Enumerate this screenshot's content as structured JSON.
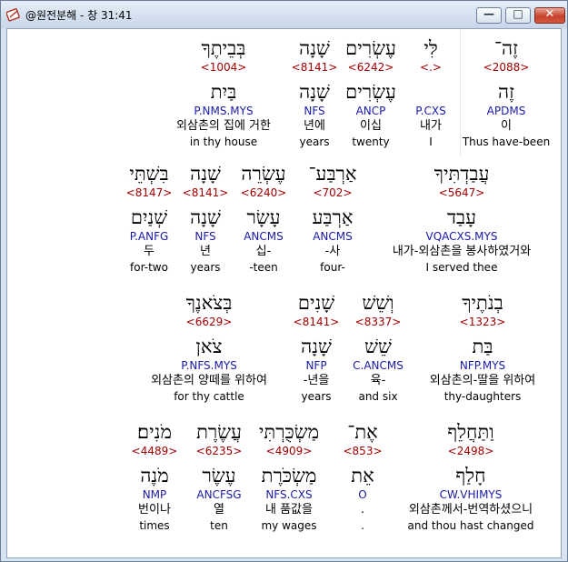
{
  "window": {
    "title": "@원전분해 - 창 31:41",
    "min_glyph": "—",
    "max_glyph": "□",
    "close_glyph": "✕"
  },
  "lines": [
    {
      "words": [
        {
          "heb": "זֶה־",
          "strong": "<2088>",
          "lex": "זֶה",
          "morph": "APDMS",
          "kor": "이",
          "eng": "Thus have-been"
        },
        {
          "heb": "לִּי",
          "strong": "<.>",
          "lex": "",
          "morph": "P.CXS",
          "kor": "내가",
          "eng": "I"
        },
        {
          "heb": "עֶשְׂרִים",
          "strong": "<6242>",
          "lex": "עֶשְׂרִים",
          "morph": "ANCP",
          "kor": "이십",
          "eng": "twenty"
        },
        {
          "heb": "שָׁנָה",
          "strong": "<8141>",
          "lex": "שָׁנָה",
          "morph": "NFS",
          "kor": "년에",
          "eng": "years"
        },
        {
          "heb": "בְּבֵיתֶךָ",
          "strong": "<1004>",
          "lex": "בַּיִת",
          "morph": "P.NMS.MYS",
          "kor": "외삼촌의 집에 거한",
          "eng": "in thy house"
        }
      ]
    },
    {
      "words": [
        {
          "heb": "עֲבַדְתִּיךָ",
          "strong": "<5647>",
          "lex": "עָבַד",
          "morph": "VQACXS.MYS",
          "kor": "내가-외삼촌을 봉사하였거와",
          "eng": "I served thee"
        },
        {
          "heb": "אַרְבַּע־",
          "strong": "<702>",
          "lex": "אַרְבַּע",
          "morph": "ANCMS",
          "kor": "-사",
          "eng": "four-"
        },
        {
          "heb": "עֶשְׂרֵה",
          "strong": "<6240>",
          "lex": "עָשָׂר",
          "morph": "ANCMS",
          "kor": "십-",
          "eng": "-teen"
        },
        {
          "heb": "שָׁנָה",
          "strong": "<8141>",
          "lex": "שָׁנָה",
          "morph": "NFS",
          "kor": "년",
          "eng": "years"
        },
        {
          "heb": "בִּשְׁתֵּי",
          "strong": "<8147>",
          "lex": "שְׁנַיִם",
          "morph": "P.ANFG",
          "kor": "두",
          "eng": "for-two"
        }
      ]
    },
    {
      "words": [
        {
          "heb": "בְנֹתֶיךָ",
          "strong": "<1323>",
          "lex": "בַּת",
          "morph": "NFP.MYS",
          "kor": "외삼촌의-딸을 위하여",
          "eng": "thy-daughters"
        },
        {
          "heb": "וְשֵׁשׁ",
          "strong": "<8337>",
          "lex": "שֵׁשׁ",
          "morph": "C.ANCMS",
          "kor": "육-",
          "eng": "and six"
        },
        {
          "heb": "שָׁנִים",
          "strong": "<8141>",
          "lex": "שָׁנָה",
          "morph": "NFP",
          "kor": "-년을",
          "eng": "years"
        },
        {
          "heb": "בְּצֹאנֶךָ",
          "strong": "<6629>",
          "lex": "צֹאן",
          "morph": "P.NFS.MYS",
          "kor": "외삼촌의 양떼를 위하여",
          "eng": "for thy cattle"
        }
      ]
    },
    {
      "words": [
        {
          "heb": "וַתַּחֲלֵף",
          "strong": "<2498>",
          "lex": "חָלַף",
          "morph": "CW.VHIMYS",
          "kor": "외삼촌께서-번역하셨으니",
          "eng": "and thou hast changed"
        },
        {
          "heb": "אֶת־",
          "strong": "<853>",
          "lex": "אֵת",
          "morph": "O",
          "kor": ".",
          "eng": "."
        },
        {
          "heb": "מַשְׂכֻּרְתִּי",
          "strong": "<4909>",
          "lex": "מַשְׂכֹּרֶת",
          "morph": "NFS.CXS",
          "kor": "내 품값을",
          "eng": "my wages"
        },
        {
          "heb": "עֲשֶׂרֶת",
          "strong": "<6235>",
          "lex": "עֶשֶׂר",
          "morph": "ANCFSG",
          "kor": "열",
          "eng": "ten"
        },
        {
          "heb": "מֹנִים׃",
          "strong": "<4489>",
          "lex": "מֹנֶה",
          "morph": "NMP",
          "kor": "번이나",
          "eng": "times"
        }
      ]
    }
  ]
}
